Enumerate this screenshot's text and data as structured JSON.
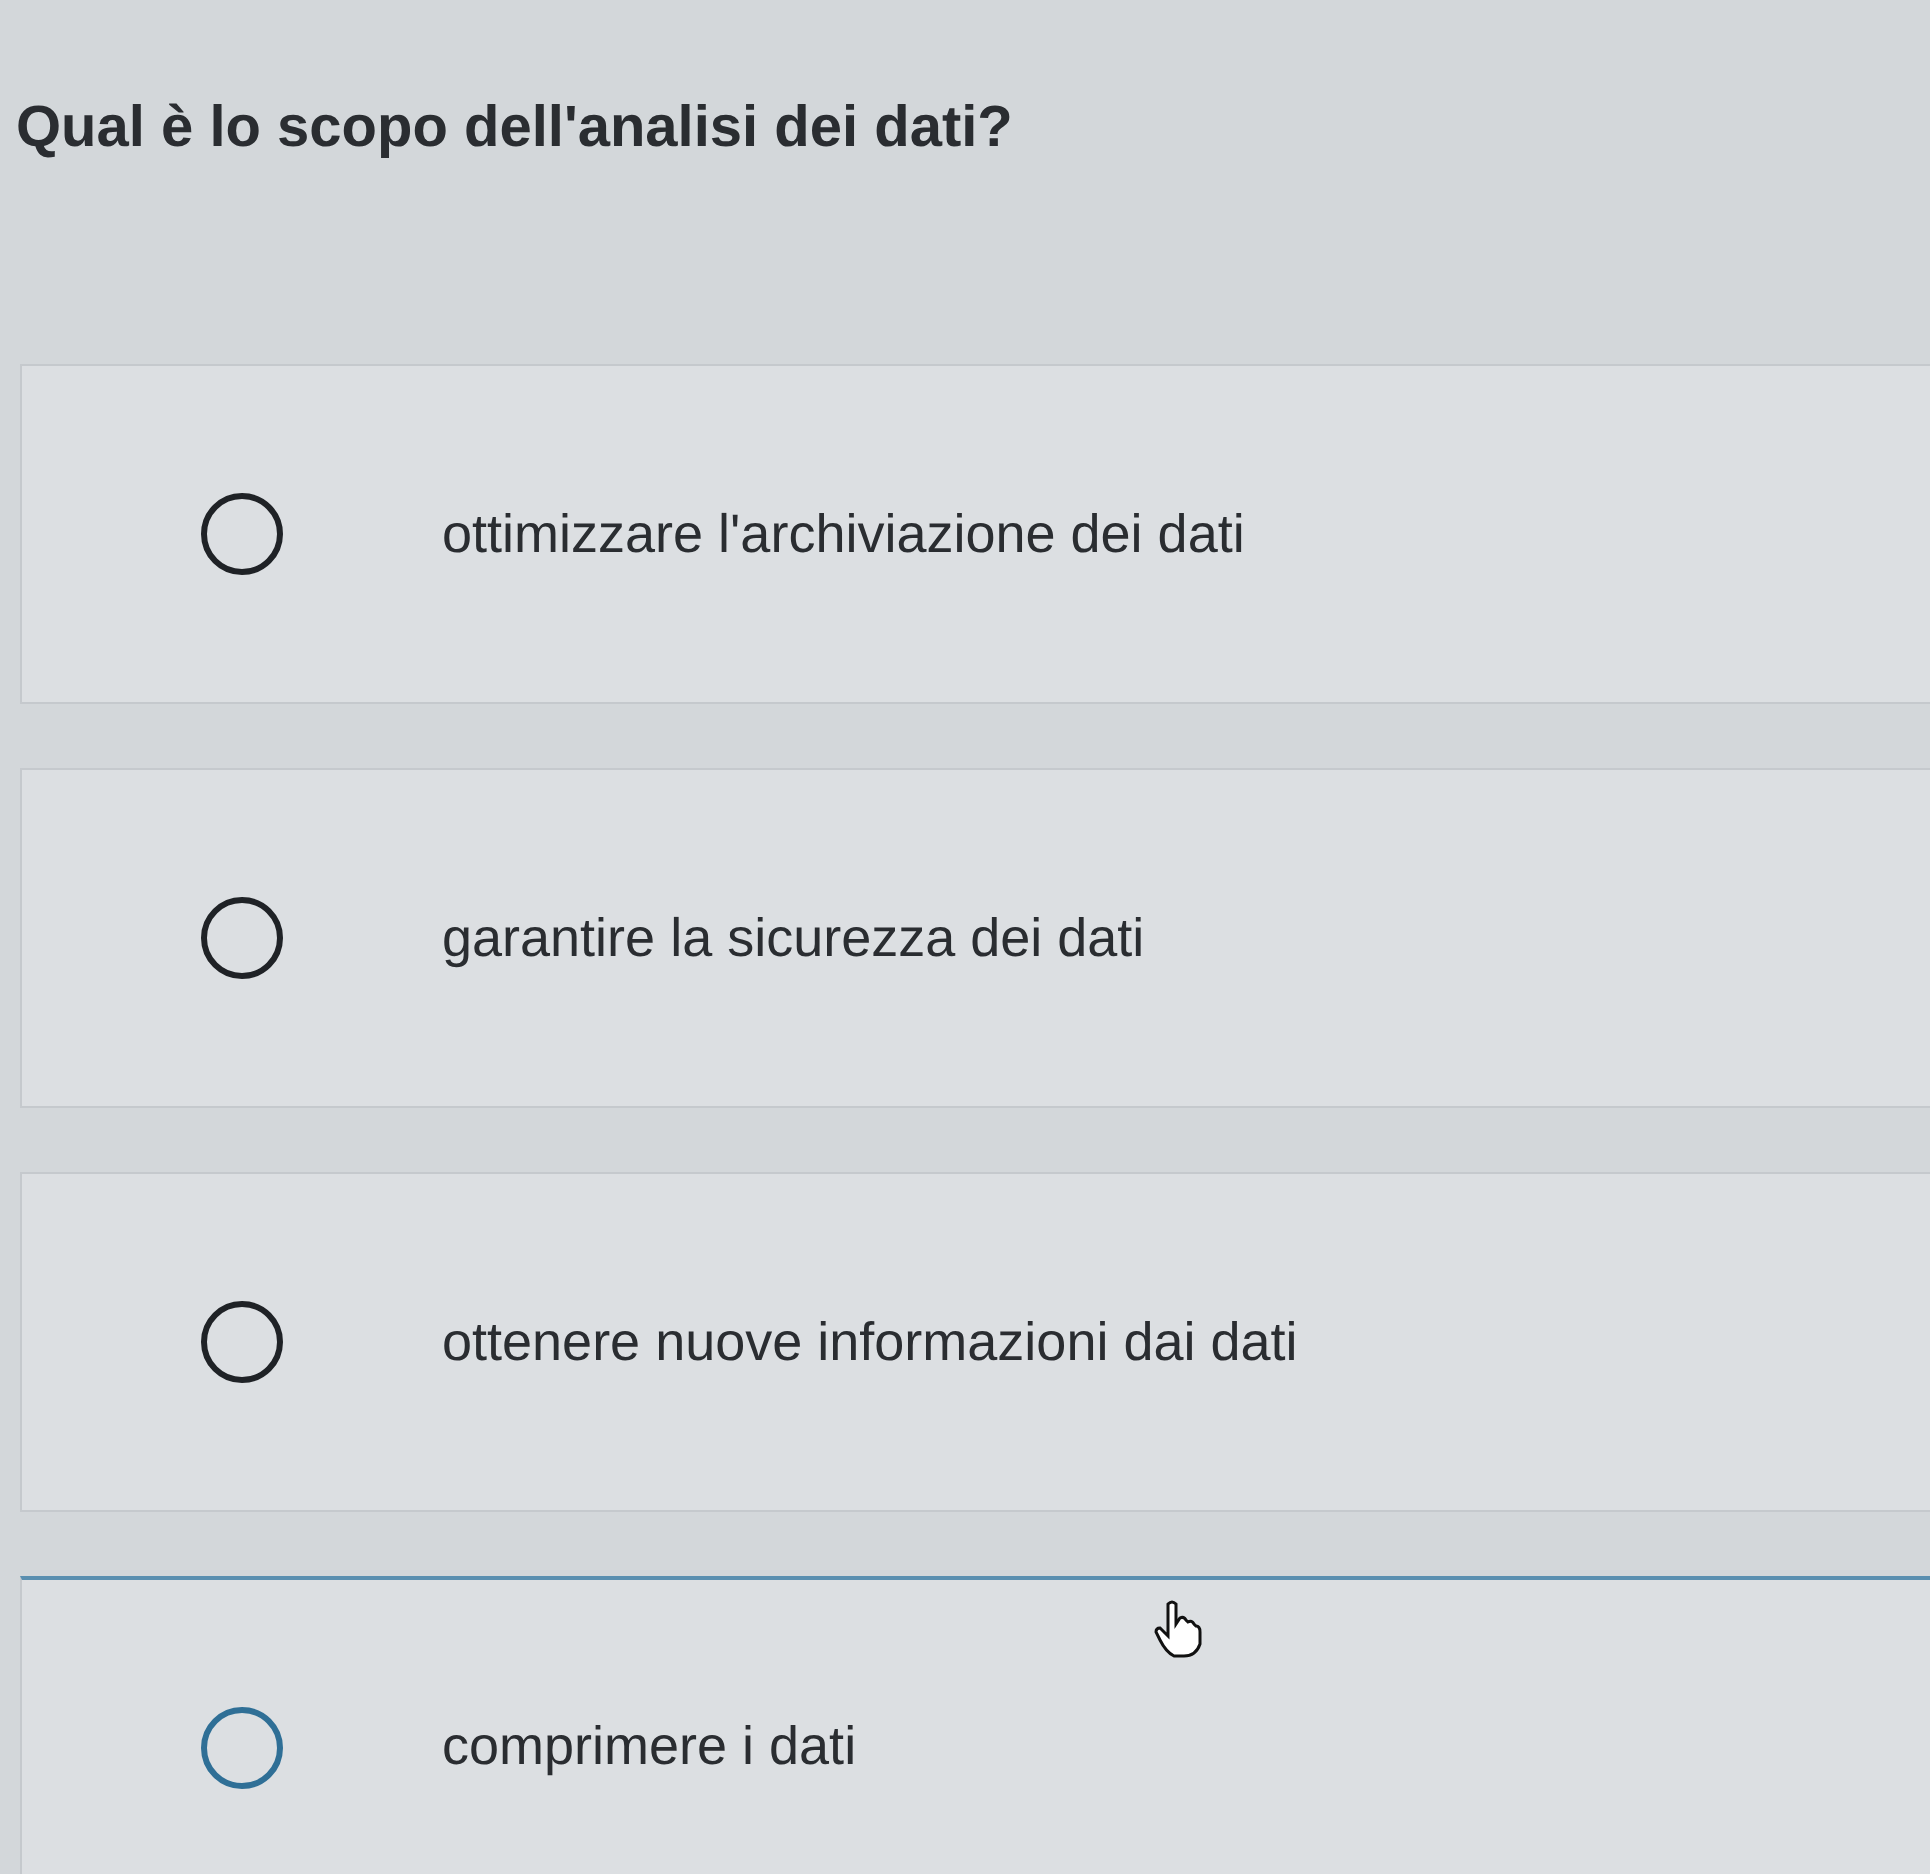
{
  "question": "Qual è lo scopo dell'analisi dei dati?",
  "options": [
    {
      "label": "ottimizzare l'archiviazione dei dati",
      "selected": false,
      "hovered": false
    },
    {
      "label": "garantire la sicurezza dei dati",
      "selected": false,
      "hovered": false
    },
    {
      "label": "ottenere nuove informazioni dai dati",
      "selected": false,
      "hovered": false
    },
    {
      "label": "comprimere i dati",
      "selected": false,
      "hovered": true
    }
  ]
}
